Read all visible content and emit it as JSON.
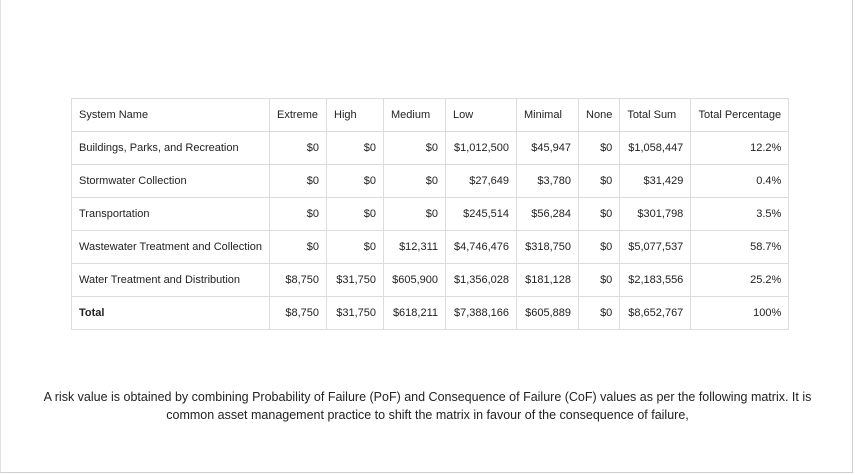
{
  "table": {
    "headers": [
      "System Name",
      "Extreme",
      "High",
      "Medium",
      "Low",
      "Minimal",
      "None",
      "Total Sum",
      "Total Percentage"
    ],
    "rows": [
      {
        "name": "Buildings, Parks, and Recreation",
        "extreme": "$0",
        "high": "$0",
        "medium": "$0",
        "low": "$1,012,500",
        "minimal": "$45,947",
        "none": "$0",
        "total_sum": "$1,058,447",
        "total_percentage": "12.2%"
      },
      {
        "name": "Stormwater Collection",
        "extreme": "$0",
        "high": "$0",
        "medium": "$0",
        "low": "$27,649",
        "minimal": "$3,780",
        "none": "$0",
        "total_sum": "$31,429",
        "total_percentage": "0.4%"
      },
      {
        "name": "Transportation",
        "extreme": "$0",
        "high": "$0",
        "medium": "$0",
        "low": "$245,514",
        "minimal": "$56,284",
        "none": "$0",
        "total_sum": "$301,798",
        "total_percentage": "3.5%"
      },
      {
        "name": "Wastewater Treatment and Collection",
        "extreme": "$0",
        "high": "$0",
        "medium": "$12,311",
        "low": "$4,746,476",
        "minimal": "$318,750",
        "none": "$0",
        "total_sum": "$5,077,537",
        "total_percentage": "58.7%"
      },
      {
        "name": "Water Treatment and Distribution",
        "extreme": "$8,750",
        "high": "$31,750",
        "medium": "$605,900",
        "low": "$1,356,028",
        "minimal": "$181,128",
        "none": "$0",
        "total_sum": "$2,183,556",
        "total_percentage": "25.2%"
      },
      {
        "name": "Total",
        "extreme": "$8,750",
        "high": "$31,750",
        "medium": "$618,211",
        "low": "$7,388,166",
        "minimal": "$605,889",
        "none": "$0",
        "total_sum": "$8,652,767",
        "total_percentage": "100%"
      }
    ]
  },
  "paragraph": "A risk value is obtained by combining Probability of Failure (PoF) and Consequence of Failure (CoF) values as per the following matrix. It is common asset management practice to shift the matrix in favour of the consequence of failure,"
}
